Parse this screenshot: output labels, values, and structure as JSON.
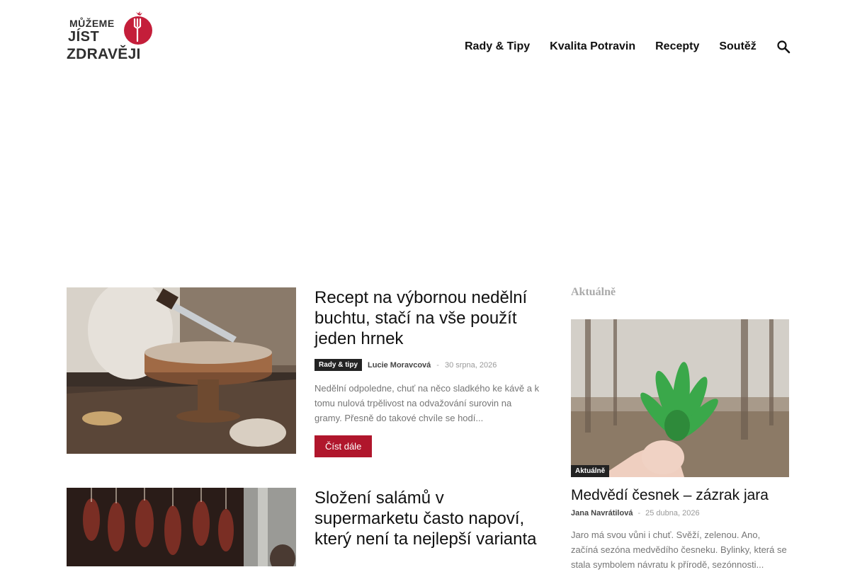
{
  "brand": {
    "line1": "MŮŽEME",
    "line2": "JÍST",
    "line3": "ZDRAVĚJI",
    "accent": "#c41e3a"
  },
  "nav": {
    "items": [
      "Rady & Tipy",
      "Kvalita Potravin",
      "Recepty",
      "Soutěž"
    ],
    "search_icon": "search-icon"
  },
  "articles": [
    {
      "title": "Recept na výbornou nedělní buchtu, stačí na vše použít jeden hrnek",
      "category": "Rady & tipy",
      "author": "Lucie Moravcová",
      "separator": "-",
      "date": "30 srpna, 2026",
      "excerpt": "Nedělní odpoledne, chuť na něco sladkého ke kávě a k tomu nulová trpělivost na odvažování surovin na gramy. Přesně do takové chvíle se hodí...",
      "read_more": "Číst dále"
    },
    {
      "title": "Složení salámů v supermarketu často napoví, který není ta nejlepší varianta"
    }
  ],
  "sidebar": {
    "heading": "Aktuálně",
    "post": {
      "category": "Aktuálně",
      "title": "Medvědí česnek – zázrak jara",
      "author": "Jana Navrátilová",
      "separator": "-",
      "date": "25 dubna, 2026",
      "excerpt": "Jaro má svou vůni i chuť. Svěží, zelenou. Ano, začíná sezóna medvědího česneku. Bylinky, která se stala symbolem návratu k přírodě, sezónnosti..."
    }
  },
  "colors": {
    "button": "#b0162c",
    "badge": "#222222",
    "meta_gray": "#999999",
    "excerpt_gray": "#767676"
  }
}
